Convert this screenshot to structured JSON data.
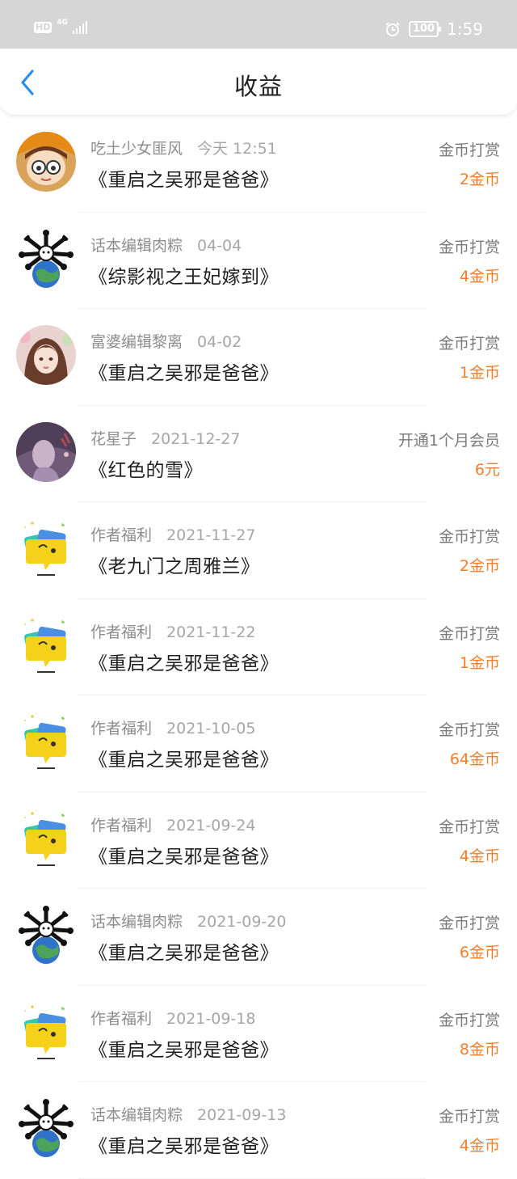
{
  "status_bar": {
    "hd": "HD",
    "network": "4G",
    "battery": "100",
    "time": "1:59",
    "icons": [
      "signal-icon",
      "alarm-clock-icon",
      "battery-icon"
    ]
  },
  "header": {
    "title": "收益",
    "back_icon": "chevron-left-icon",
    "accent_color": "#2d8cf0"
  },
  "colors": {
    "amount": "#f07f2e",
    "status_bar_bg": "#d6d6d6"
  },
  "records": [
    {
      "user": "吃土少女匪风",
      "date": "今天 12:51",
      "book": "《重启之吴邪是爸爸》",
      "type": "金币打赏",
      "amount": "2金币",
      "avatar": "cartoon-girl"
    },
    {
      "user": "话本编辑肉粽",
      "date": "04-04",
      "book": "《综影视之王妃嫁到》",
      "type": "金币打赏",
      "amount": "4金币",
      "avatar": "globe-figure"
    },
    {
      "user": "富婆编辑黎离",
      "date": "04-02",
      "book": "《重启之吴邪是爸爸》",
      "type": "金币打赏",
      "amount": "1金币",
      "avatar": "anime-woman"
    },
    {
      "user": "花星子",
      "date": "2021-12-27",
      "book": "《红色的雪》",
      "type": "开通1个月会员",
      "amount": "6元",
      "avatar": "purple-portrait"
    },
    {
      "user": "作者福利",
      "date": "2021-11-27",
      "book": "《老九门之周雅兰》",
      "type": "金币打赏",
      "amount": "2金币",
      "avatar": "yellow-bubble"
    },
    {
      "user": "作者福利",
      "date": "2021-11-22",
      "book": "《重启之吴邪是爸爸》",
      "type": "金币打赏",
      "amount": "1金币",
      "avatar": "yellow-bubble"
    },
    {
      "user": "作者福利",
      "date": "2021-10-05",
      "book": "《重启之吴邪是爸爸》",
      "type": "金币打赏",
      "amount": "64金币",
      "avatar": "yellow-bubble"
    },
    {
      "user": "作者福利",
      "date": "2021-09-24",
      "book": "《重启之吴邪是爸爸》",
      "type": "金币打赏",
      "amount": "4金币",
      "avatar": "yellow-bubble"
    },
    {
      "user": "话本编辑肉粽",
      "date": "2021-09-20",
      "book": "《重启之吴邪是爸爸》",
      "type": "金币打赏",
      "amount": "6金币",
      "avatar": "globe-figure"
    },
    {
      "user": "作者福利",
      "date": "2021-09-18",
      "book": "《重启之吴邪是爸爸》",
      "type": "金币打赏",
      "amount": "8金币",
      "avatar": "yellow-bubble"
    },
    {
      "user": "话本编辑肉粽",
      "date": "2021-09-13",
      "book": "《重启之吴邪是爸爸》",
      "type": "金币打赏",
      "amount": "4金币",
      "avatar": "globe-figure"
    }
  ]
}
